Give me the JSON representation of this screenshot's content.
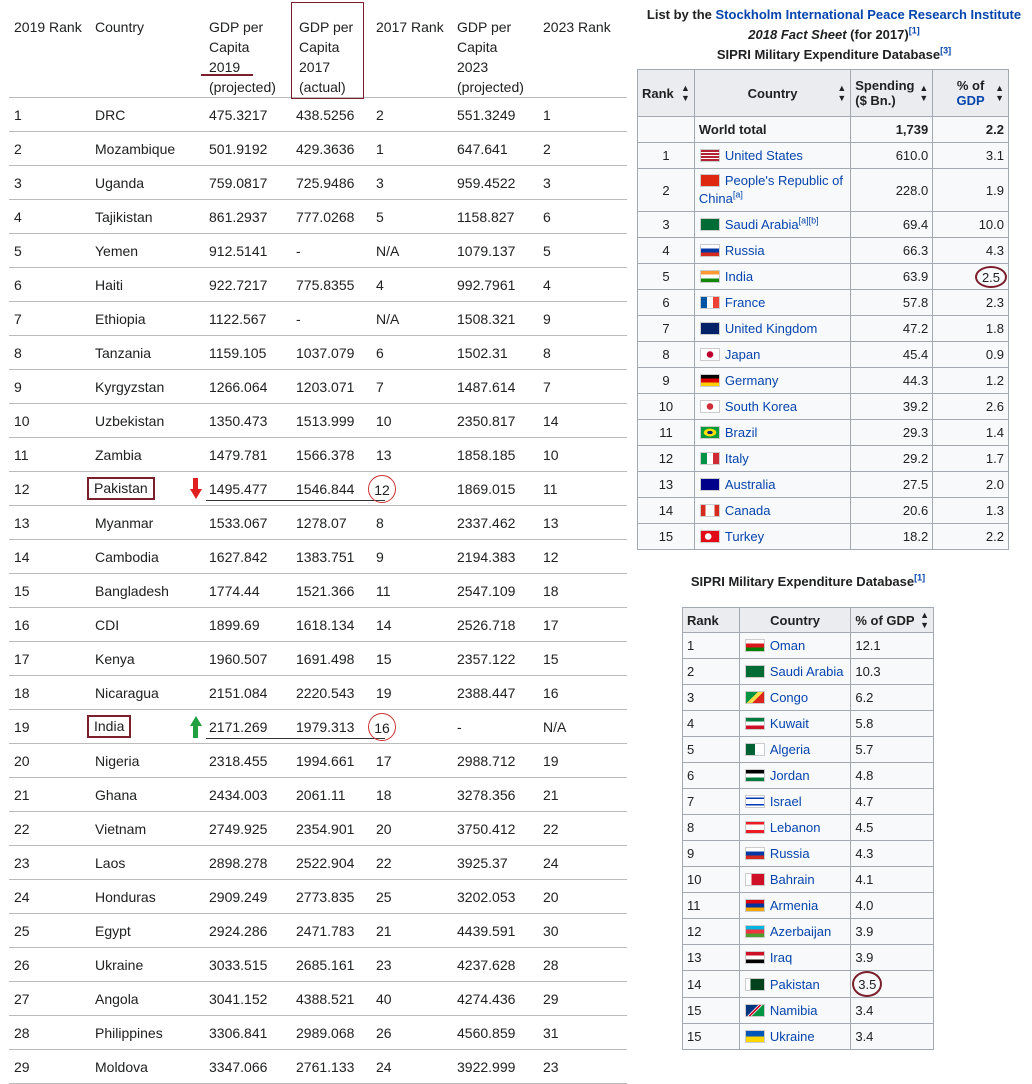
{
  "gdp": {
    "headers": [
      "2019 Rank",
      "Country",
      "GDP per Capita 2019 (projected)",
      "GDP per Capita 2017 (actual)",
      "2017 Rank",
      "GDP per Capita 2023 (projected)",
      "2023 Rank"
    ],
    "header_lines": {
      "gdp2019": [
        "GDP per",
        "Capita",
        "2019",
        "(projected)"
      ],
      "gdp2017": [
        "GDP per",
        "Capita",
        "2017",
        "(actual)"
      ],
      "gdp2023": [
        "GDP per",
        "Capita",
        "2023",
        "(projected)"
      ]
    },
    "rows": [
      [
        "1",
        "DRC",
        "475.3217",
        "438.5256",
        "2",
        "551.3249",
        "1"
      ],
      [
        "2",
        "Mozambique",
        "501.9192",
        "429.3636",
        "1",
        "647.641",
        "2"
      ],
      [
        "3",
        "Uganda",
        "759.0817",
        "725.9486",
        "3",
        "959.4522",
        "3"
      ],
      [
        "4",
        "Tajikistan",
        "861.2937",
        "777.0268",
        "5",
        "1158.827",
        "6"
      ],
      [
        "5",
        "Yemen",
        "912.5141",
        "-",
        "N/A",
        "1079.137",
        "5"
      ],
      [
        "6",
        "Haiti",
        "922.7217",
        "775.8355",
        "4",
        "992.7961",
        "4"
      ],
      [
        "7",
        "Ethiopia",
        "1122.567",
        "-",
        "N/A",
        "1508.321",
        "9"
      ],
      [
        "8",
        "Tanzania",
        "1159.105",
        "1037.079",
        "6",
        "1502.31",
        "8"
      ],
      [
        "9",
        "Kyrgyzstan",
        "1266.064",
        "1203.071",
        "7",
        "1487.614",
        "7"
      ],
      [
        "10",
        "Uzbekistan",
        "1350.473",
        "1513.999",
        "10",
        "2350.817",
        "14"
      ],
      [
        "11",
        "Zambia",
        "1479.781",
        "1566.378",
        "13",
        "1858.185",
        "10"
      ],
      [
        "12",
        "Pakistan",
        "1495.477",
        "1546.844",
        "12",
        "1869.015",
        "11"
      ],
      [
        "13",
        "Myanmar",
        "1533.067",
        "1278.07",
        "8",
        "2337.462",
        "13"
      ],
      [
        "14",
        "Cambodia",
        "1627.842",
        "1383.751",
        "9",
        "2194.383",
        "12"
      ],
      [
        "15",
        "Bangladesh",
        "1774.44",
        "1521.366",
        "11",
        "2547.109",
        "18"
      ],
      [
        "16",
        "CDI",
        "1899.69",
        "1618.134",
        "14",
        "2526.718",
        "17"
      ],
      [
        "17",
        "Kenya",
        "1960.507",
        "1691.498",
        "15",
        "2357.122",
        "15"
      ],
      [
        "18",
        "Nicaragua",
        "2151.084",
        "2220.543",
        "19",
        "2388.447",
        "16"
      ],
      [
        "19",
        "India",
        "2171.269",
        "1979.313",
        "16",
        "-",
        "N/A"
      ],
      [
        "20",
        "Nigeria",
        "2318.455",
        "1994.661",
        "17",
        "2988.712",
        "19"
      ],
      [
        "21",
        "Ghana",
        "2434.003",
        "2061.11",
        "18",
        "3278.356",
        "21"
      ],
      [
        "22",
        "Vietnam",
        "2749.925",
        "2354.901",
        "20",
        "3750.412",
        "22"
      ],
      [
        "23",
        "Laos",
        "2898.278",
        "2522.904",
        "22",
        "3925.37",
        "24"
      ],
      [
        "24",
        "Honduras",
        "2909.249",
        "2773.835",
        "25",
        "3202.053",
        "20"
      ],
      [
        "25",
        "Egypt",
        "2924.286",
        "2471.783",
        "21",
        "4439.591",
        "30"
      ],
      [
        "26",
        "Ukraine",
        "3033.515",
        "2685.161",
        "23",
        "4237.628",
        "28"
      ],
      [
        "27",
        "Angola",
        "3041.152",
        "4388.521",
        "40",
        "4274.436",
        "29"
      ],
      [
        "28",
        "Philippines",
        "3306.841",
        "2989.068",
        "26",
        "4560.859",
        "31"
      ],
      [
        "29",
        "Moldova",
        "3347.066",
        "2761.133",
        "24",
        "3922.999",
        "23"
      ]
    ]
  },
  "sipri1": {
    "caption_prefix": "List by the ",
    "caption_link": "Stockholm International Peace Research Institute",
    "caption_italic": "2018 Fact Sheet",
    "caption_suffix": " (for 2017)",
    "caption_ref": "[1]",
    "subtitle": "SIPRI Military Expenditure Database",
    "subtitle_ref": "[3]",
    "headers": {
      "rank": "Rank",
      "country": "Country",
      "spending1": "Spending",
      "spending2": "($ Bn.)",
      "pct1": "% of",
      "pct2": "GDP"
    },
    "world": {
      "label": "World total",
      "spending": "1,739",
      "pct": "2.2"
    },
    "rows": [
      {
        "rank": "1",
        "country": "United States",
        "spending": "610.0",
        "pct": "3.1",
        "flag": "us"
      },
      {
        "rank": "2",
        "country": "People's Republic of China",
        "ref": "[a]",
        "spending": "228.0",
        "pct": "1.9",
        "flag": "cn"
      },
      {
        "rank": "3",
        "country": "Saudi Arabia",
        "ref": "[a][b]",
        "spending": "69.4",
        "pct": "10.0",
        "flag": "sa"
      },
      {
        "rank": "4",
        "country": "Russia",
        "spending": "66.3",
        "pct": "4.3",
        "flag": "ru"
      },
      {
        "rank": "5",
        "country": "India",
        "spending": "63.9",
        "pct": "2.5",
        "flag": "in"
      },
      {
        "rank": "6",
        "country": "France",
        "spending": "57.8",
        "pct": "2.3",
        "flag": "fr"
      },
      {
        "rank": "7",
        "country": "United Kingdom",
        "spending": "47.2",
        "pct": "1.8",
        "flag": "uk"
      },
      {
        "rank": "8",
        "country": "Japan",
        "spending": "45.4",
        "pct": "0.9",
        "flag": "jp"
      },
      {
        "rank": "9",
        "country": "Germany",
        "spending": "44.3",
        "pct": "1.2",
        "flag": "de"
      },
      {
        "rank": "10",
        "country": "South Korea",
        "spending": "39.2",
        "pct": "2.6",
        "flag": "kr"
      },
      {
        "rank": "11",
        "country": "Brazil",
        "spending": "29.3",
        "pct": "1.4",
        "flag": "br"
      },
      {
        "rank": "12",
        "country": "Italy",
        "spending": "29.2",
        "pct": "1.7",
        "flag": "it"
      },
      {
        "rank": "13",
        "country": "Australia",
        "spending": "27.5",
        "pct": "2.0",
        "flag": "au"
      },
      {
        "rank": "14",
        "country": "Canada",
        "spending": "20.6",
        "pct": "1.3",
        "flag": "ca"
      },
      {
        "rank": "15",
        "country": "Turkey",
        "spending": "18.2",
        "pct": "2.2",
        "flag": "tr"
      }
    ]
  },
  "sipri2": {
    "caption": "SIPRI Military Expenditure Database",
    "caption_ref": "[1]",
    "headers": {
      "rank": "Rank",
      "country": "Country",
      "pct": "% of GDP"
    },
    "rows": [
      {
        "rank": "1",
        "country": "Oman",
        "pct": "12.1",
        "flag": "om"
      },
      {
        "rank": "2",
        "country": "Saudi Arabia",
        "pct": "10.3",
        "flag": "sa"
      },
      {
        "rank": "3",
        "country": "Congo",
        "pct": "6.2",
        "flag": "cg"
      },
      {
        "rank": "4",
        "country": "Kuwait",
        "pct": "5.8",
        "flag": "kw"
      },
      {
        "rank": "5",
        "country": "Algeria",
        "pct": "5.7",
        "flag": "dz"
      },
      {
        "rank": "6",
        "country": "Jordan",
        "pct": "4.8",
        "flag": "jo"
      },
      {
        "rank": "7",
        "country": "Israel",
        "pct": "4.7",
        "flag": "il"
      },
      {
        "rank": "8",
        "country": "Lebanon",
        "pct": "4.5",
        "flag": "lb"
      },
      {
        "rank": "9",
        "country": "Russia",
        "pct": "4.3",
        "flag": "ru"
      },
      {
        "rank": "10",
        "country": "Bahrain",
        "pct": "4.1",
        "flag": "bh"
      },
      {
        "rank": "11",
        "country": "Armenia",
        "pct": "4.0",
        "flag": "am"
      },
      {
        "rank": "12",
        "country": "Azerbaijan",
        "pct": "3.9",
        "flag": "az"
      },
      {
        "rank": "13",
        "country": "Iraq",
        "pct": "3.9",
        "flag": "iq"
      },
      {
        "rank": "14",
        "country": "Pakistan",
        "pct": "3.5",
        "flag": "pk"
      },
      {
        "rank": "15",
        "country": "Namibia",
        "pct": "3.4",
        "flag": "na"
      },
      {
        "rank": "15",
        "country": "Ukraine",
        "pct": "3.4",
        "flag": "ua"
      }
    ]
  },
  "flag_styles": {
    "us": "repeating-linear-gradient(180deg,#b22234 0 2px,#fff 2px 3px)",
    "cn": "#de2910",
    "sa": "#006c35",
    "ru": "linear-gradient(180deg,#fff 0 33%,#0039a6 33% 66%,#d52b1e 66%)",
    "in": "linear-gradient(180deg,#ff9933 0 33%,#fff 33% 66%,#138808 66%)",
    "fr": "linear-gradient(90deg,#0055a4 0 33%,#fff 33% 66%,#ef4135 66%)",
    "uk": "#012169",
    "jp": "radial-gradient(circle,#bc002d 0 3px,#fff 3.5px)",
    "de": "linear-gradient(180deg,#000 0 33%,#dd0000 33% 66%,#ffce00 66%)",
    "kr": "radial-gradient(circle,#cd2e3a 0 3px,#fff 3.5px)",
    "br": "radial-gradient(ellipse,#002776 0 2.5px,#fedf00 3px 6px,#009c3b 6.5px)",
    "it": "linear-gradient(90deg,#009246 0 33%,#fff 33% 66%,#ce2b37 66%)",
    "au": "#00008b",
    "ca": "linear-gradient(90deg,#d52b1e 0 25%,#fff 25% 75%,#d52b1e 75%)",
    "tr": "radial-gradient(circle at 40% 50%,#fff 0 3px,#e30a17 3.5px)",
    "om": "linear-gradient(180deg,#fff 0 33%,#db161b 33% 66%,#008000 66%)",
    "cg": "linear-gradient(135deg,#009543 0 40%,#fbde4a 40% 60%,#dc241f 60%)",
    "kw": "linear-gradient(180deg,#007a3d 0 33%,#fff 33% 66%,#ce1126 66%)",
    "dz": "linear-gradient(90deg,#006233 0 50%,#fff 50%)",
    "jo": "linear-gradient(180deg,#000 0 33%,#fff 33% 66%,#007a3d 66%)",
    "il": "linear-gradient(180deg,#fff 0 15%,#0038b8 15% 28%,#fff 28% 72%,#0038b8 72% 85%,#fff 85%)",
    "lb": "linear-gradient(180deg,#ed1c24 0 25%,#fff 25% 75%,#ed1c24 75%)",
    "bh": "linear-gradient(90deg,#fff 0 30%,#ce1126 30%)",
    "am": "linear-gradient(180deg,#d90012 0 33%,#0033a0 33% 66%,#f2a800 66%)",
    "az": "linear-gradient(180deg,#00b5e2 0 33%,#ef3340 33% 66%,#509e2f 66%)",
    "iq": "linear-gradient(180deg,#ce1126 0 33%,#fff 33% 66%,#000 66%)",
    "pk": "linear-gradient(90deg,#fff 0 25%,#01411c 25%)",
    "na": "linear-gradient(135deg,#003580 0 42%,#fff 42% 46%,#d21034 46% 54%,#fff 54% 58%,#009543 58%)",
    "ua": "linear-gradient(180deg,#0057b7 0 50%,#ffd700 50%)"
  }
}
